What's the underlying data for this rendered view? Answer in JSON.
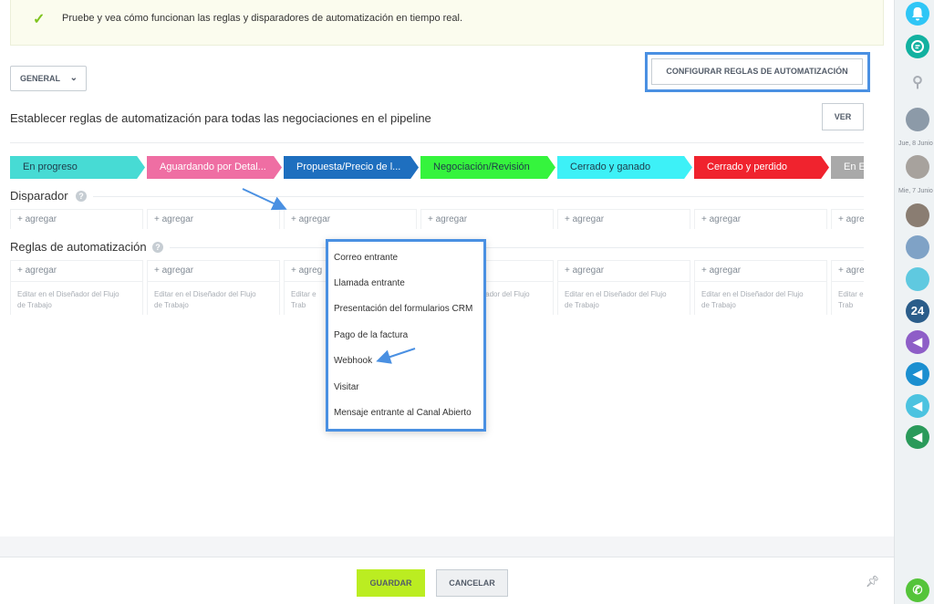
{
  "notice": {
    "text": "Pruebe y vea cómo funcionan las reglas y disparadores de automatización en tiempo real."
  },
  "toolbar": {
    "general_label": "GENERAL",
    "configure_label": "CONFIGURAR REGLAS DE AUTOMATIZACIÓN",
    "view_label": "VER"
  },
  "heading": "Establecer reglas de automatización para todas las negociaciones en el pipeline",
  "stages": [
    {
      "label": "En progreso",
      "color": "#47dbd4",
      "text_color": "#1f3b4a"
    },
    {
      "label": "Aguardando por Detal...",
      "color": "#ef6ea3",
      "text_color": "#ffffff"
    },
    {
      "label": "Propuesta/Precio de l...",
      "color": "#1e6fbf",
      "text_color": "#ffffff"
    },
    {
      "label": "Negociación/Revisión",
      "color": "#35f43d",
      "text_color": "#1f3b4a"
    },
    {
      "label": "Cerrado y ganado",
      "color": "#3df1f7",
      "text_color": "#1f3b4a"
    },
    {
      "label": "Cerrado y perdido",
      "color": "#f0232e",
      "text_color": "#ffffff"
    },
    {
      "label": "En E",
      "color": "#a9a9a9",
      "text_color": "#ffffff"
    }
  ],
  "triggers": {
    "title": "Disparador",
    "help": "?",
    "add_label": "+ agregar"
  },
  "rules": {
    "title": "Reglas de automatización",
    "help": "?",
    "add_label": "+ agregar",
    "hint_line1": "Editar en el Diseñador del Flujo",
    "hint_line2": "de Trabajo",
    "add_partial": "+ agreg",
    "hint_partial1": "Editar e",
    "hint_partial2": "Trab"
  },
  "dropdown": {
    "items": [
      "Correo entrante",
      "Llamada entrante",
      "Presentación del formularios CRM",
      "Pago de la factura",
      "Webhook",
      "Visitar",
      "Mensaje entrante al Canal Abierto"
    ]
  },
  "footer": {
    "save_label": "GUARDAR",
    "cancel_label": "CANCELAR"
  },
  "right_bar": {
    "date1": "Jue, 8 Junio",
    "date2": "Mie, 7 Junio",
    "counter": "24"
  },
  "colors": {
    "accent_blue": "#4a90e2",
    "save_green": "#bbed21",
    "check_green": "#7fc41f"
  }
}
